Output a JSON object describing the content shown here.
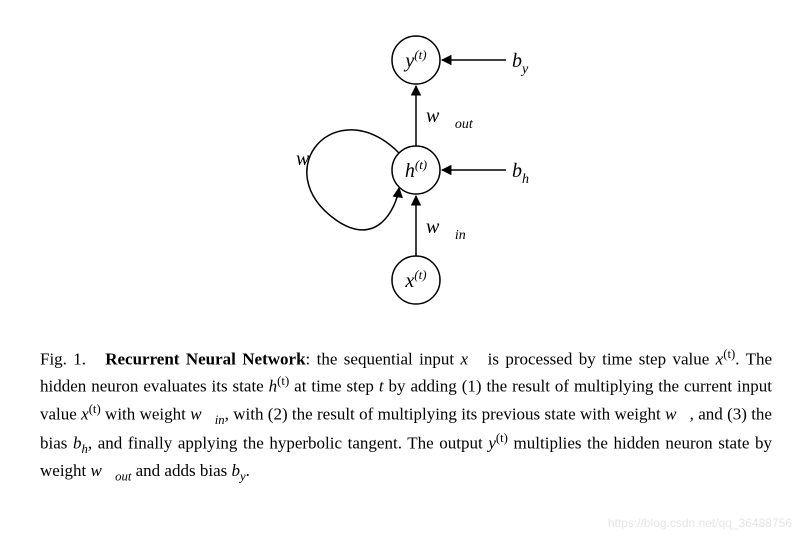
{
  "diagram": {
    "nodes": {
      "y": {
        "base": "y",
        "sup": "(t)"
      },
      "h": {
        "base": "h",
        "sup": "(t)"
      },
      "x": {
        "base": "x",
        "sup": "(t)"
      }
    },
    "edges": {
      "w_out": {
        "base": "w⃗",
        "sub": "out"
      },
      "w_in": {
        "base": "w⃗",
        "sub": "in"
      },
      "w_rec": {
        "base": "w⃗",
        "sub": ""
      },
      "b_y": {
        "base": "b",
        "sub": "y"
      },
      "b_h": {
        "base": "b",
        "sub": "h"
      }
    }
  },
  "caption": {
    "fig_label": "Fig. 1.",
    "title": "Recurrent Neural Network",
    "text_1": ": the sequential input ",
    "x_vec": "x⃗",
    "text_2": " is processed by time step value ",
    "x_t": {
      "base": "x",
      "sup": "(t)"
    },
    "text_3": ". The hidden neuron evaluates its state ",
    "h_t": {
      "base": "h",
      "sup": "(t)"
    },
    "text_4": " at time step ",
    "t_var": "t",
    "text_5": " by adding (1) the result of multiplying the current input value ",
    "x_t2": {
      "base": "x",
      "sup": "(t)"
    },
    "text_6": " with weight ",
    "w_in": {
      "base": "w⃗",
      "sub": "in"
    },
    "text_7": ", with (2) the result of multiplying its previous state with weight ",
    "w_rec": "w⃗",
    "text_8": ", and (3) the bias ",
    "b_h": {
      "base": "b",
      "sub": "h"
    },
    "text_9": ", and finally applying the hyperbolic tangent. The output ",
    "y_t": {
      "base": "y",
      "sup": "(t)"
    },
    "text_10": " multiplies the hidden neuron state by weight ",
    "w_out": {
      "base": "w⃗",
      "sub": "out"
    },
    "text_11": " and adds bias ",
    "b_y": {
      "base": "b",
      "sub": "y"
    },
    "text_12": "."
  },
  "watermark": "https://blog.csdn.net/qq_36488756"
}
